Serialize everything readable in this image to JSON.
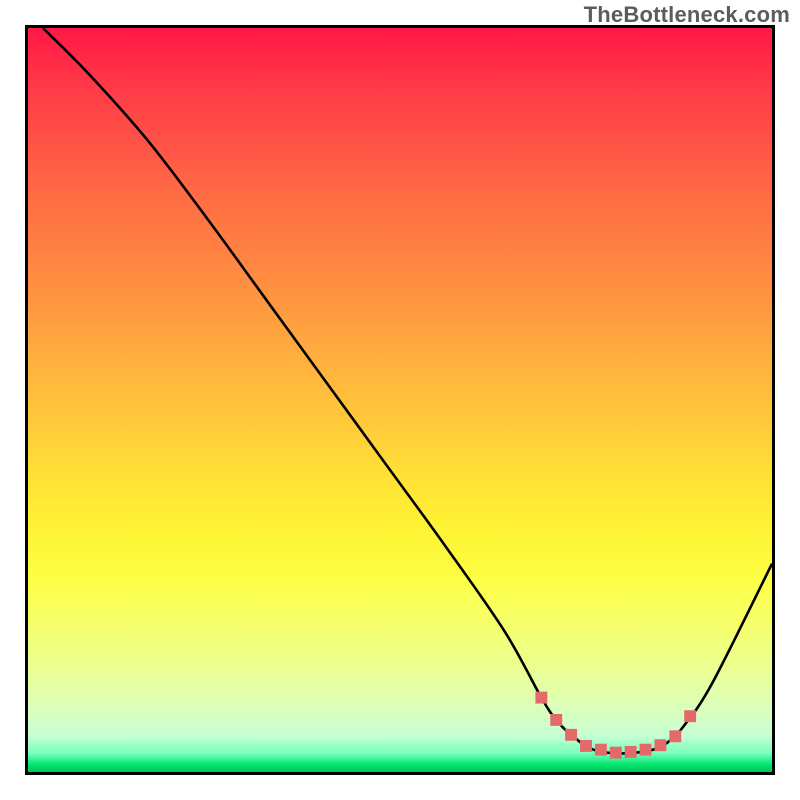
{
  "watermark": "TheBottleneck.com",
  "chart_data": {
    "type": "line",
    "title": "",
    "xlabel": "",
    "ylabel": "",
    "xlim": [
      0,
      100
    ],
    "ylim": [
      0,
      100
    ],
    "grid": false,
    "legend": false,
    "series": [
      {
        "name": "black-curve",
        "color": "#000000",
        "x": [
          2,
          8,
          16,
          24,
          32,
          40,
          48,
          56,
          64,
          69,
          71,
          73,
          76,
          80,
          84,
          86,
          88,
          92,
          100
        ],
        "y": [
          100,
          94,
          85,
          74.5,
          63.5,
          52.5,
          41.5,
          30.5,
          19,
          10,
          7,
          5,
          3,
          2.5,
          3,
          4,
          6,
          12,
          28
        ]
      },
      {
        "name": "pink-markers",
        "color": "#e46a6a",
        "x": [
          69,
          71,
          73,
          75,
          77,
          79,
          81,
          83,
          85,
          87,
          89
        ],
        "y": [
          10,
          7,
          5,
          3.5,
          3,
          2.6,
          2.7,
          3,
          3.6,
          4.8,
          7.5
        ]
      }
    ]
  }
}
